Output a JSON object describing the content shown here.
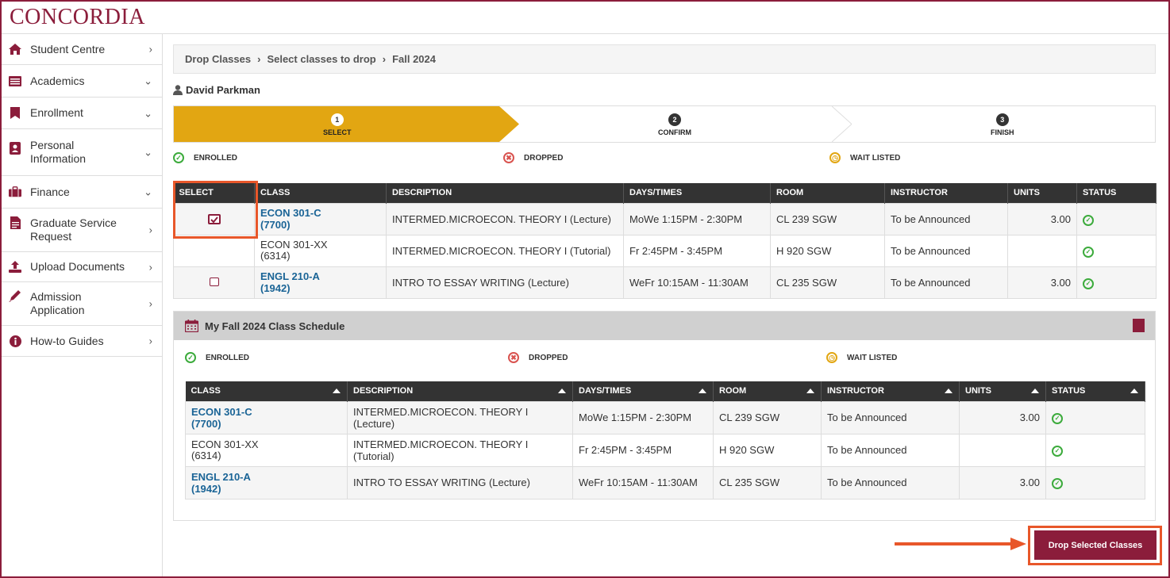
{
  "brand": {
    "logo_text": "CONCORDIA",
    "color": "#8b1d3b"
  },
  "sidebar": {
    "items": [
      {
        "label": "Student Centre",
        "icon": "home-icon",
        "chevron": "right"
      },
      {
        "label": "Academics",
        "icon": "list-icon",
        "chevron": "down"
      },
      {
        "label": "Enrollment",
        "icon": "bookmark-icon",
        "chevron": "down"
      },
      {
        "label": "Personal Information",
        "icon": "person-badge-icon",
        "chevron": "down"
      },
      {
        "label": "Finance",
        "icon": "briefcase-icon",
        "chevron": "down"
      },
      {
        "label": "Graduate Service Request",
        "icon": "document-icon",
        "chevron": "right"
      },
      {
        "label": "Upload Documents",
        "icon": "upload-icon",
        "chevron": "right"
      },
      {
        "label": "Admission Application",
        "icon": "pencil-icon",
        "chevron": "right"
      },
      {
        "label": "How-to Guides",
        "icon": "info-icon",
        "chevron": "right"
      }
    ]
  },
  "breadcrumb": [
    "Drop Classes",
    "Select classes to drop",
    "Fall 2024"
  ],
  "student": {
    "name": "David Parkman"
  },
  "stepper": {
    "steps": [
      {
        "num": "1",
        "label": "SELECT",
        "active": true
      },
      {
        "num": "2",
        "label": "CONFIRM",
        "active": false
      },
      {
        "num": "3",
        "label": "FINISH",
        "active": false
      }
    ],
    "active_color": "#e2a612"
  },
  "legend": {
    "enrolled": "ENROLLED",
    "dropped": "DROPPED",
    "wait_listed": "WAIT LISTED"
  },
  "drop_table": {
    "headers": [
      "SELECT",
      "CLASS",
      "DESCRIPTION",
      "DAYS/TIMES",
      "ROOM",
      "INSTRUCTOR",
      "UNITS",
      "STATUS"
    ],
    "rows": [
      {
        "checkbox": "checked",
        "class_code": "ECON 301-C",
        "class_num": "(7700)",
        "link": true,
        "description": "INTERMED.MICROECON. THEORY I (Lecture)",
        "days_times": "MoWe 1:15PM - 2:30PM",
        "room": "CL 239 SGW",
        "instructor": "To be Announced",
        "units": "3.00",
        "status": "enrolled"
      },
      {
        "checkbox": "none",
        "class_code": "ECON 301-XX",
        "class_num": "(6314)",
        "link": false,
        "description": "INTERMED.MICROECON. THEORY I (Tutorial)",
        "days_times": "Fr 2:45PM - 3:45PM",
        "room": "H 920 SGW",
        "instructor": "To be Announced",
        "units": "",
        "status": "enrolled"
      },
      {
        "checkbox": "unchecked",
        "class_code": "ENGL 210-A",
        "class_num": "(1942)",
        "link": true,
        "description": "INTRO TO ESSAY WRITING (Lecture)",
        "days_times": "WeFr 10:15AM - 11:30AM",
        "room": "CL 235 SGW",
        "instructor": "To be Announced",
        "units": "3.00",
        "status": "enrolled"
      }
    ]
  },
  "schedule": {
    "title": "My Fall 2024 Class Schedule",
    "headers": [
      "CLASS",
      "DESCRIPTION",
      "DAYS/TIMES",
      "ROOM",
      "INSTRUCTOR",
      "UNITS",
      "STATUS"
    ],
    "rows": [
      {
        "class_code": "ECON 301-C",
        "class_num": "(7700)",
        "link": true,
        "description": "INTERMED.MICROECON. THEORY I (Lecture)",
        "days_times": "MoWe 1:15PM - 2:30PM",
        "room": "CL 239 SGW",
        "instructor": "To be Announced",
        "units": "3.00",
        "status": "enrolled"
      },
      {
        "class_code": "ECON 301-XX",
        "class_num": "(6314)",
        "link": false,
        "description": "INTERMED.MICROECON. THEORY I (Tutorial)",
        "days_times": "Fr 2:45PM - 3:45PM",
        "room": "H 920 SGW",
        "instructor": "To be Announced",
        "units": "",
        "status": "enrolled"
      },
      {
        "class_code": "ENGL 210-A",
        "class_num": "(1942)",
        "link": true,
        "description": "INTRO TO ESSAY WRITING (Lecture)",
        "days_times": "WeFr 10:15AM - 11:30AM",
        "room": "CL 235 SGW",
        "instructor": "To be Announced",
        "units": "3.00",
        "status": "enrolled"
      }
    ]
  },
  "actions": {
    "drop_label": "Drop Selected Classes"
  },
  "colors": {
    "enrolled": "#3cab3c",
    "dropped": "#d9534f",
    "wait_listed": "#e2a612",
    "highlight": "#e8572a"
  }
}
